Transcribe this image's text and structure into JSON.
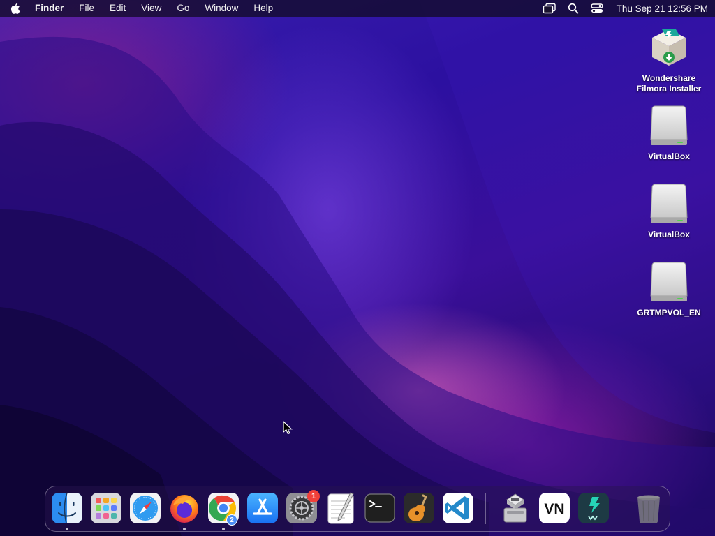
{
  "menubar": {
    "app_name": "Finder",
    "items": [
      "File",
      "Edit",
      "View",
      "Go",
      "Window",
      "Help"
    ],
    "clock": "Thu Sep 21  12:56 PM",
    "status_icons": [
      "screen-mirroring-icon",
      "spotlight-search-icon",
      "control-center-icon"
    ]
  },
  "desktop_icons": [
    {
      "label": "Wondershare Filmora Installer",
      "icon": "package-installer-icon"
    },
    {
      "label": "VirtualBox",
      "icon": "external-drive-icon"
    },
    {
      "label": "VirtualBox",
      "icon": "external-drive-icon"
    },
    {
      "label": "GRTMPVOL_EN",
      "icon": "external-drive-icon"
    }
  ],
  "dock": {
    "apps": [
      {
        "name": "Finder",
        "icon": "finder-icon",
        "running": true
      },
      {
        "name": "Launchpad",
        "icon": "launchpad-icon",
        "running": false
      },
      {
        "name": "Safari",
        "icon": "safari-icon",
        "running": false
      },
      {
        "name": "Firefox",
        "icon": "firefox-icon",
        "running": true
      },
      {
        "name": "Google Chrome",
        "icon": "chrome-icon",
        "running": true,
        "window_count": "2"
      },
      {
        "name": "App Store",
        "icon": "app-store-icon",
        "running": false
      },
      {
        "name": "System Settings",
        "icon": "system-settings-icon",
        "running": false,
        "badge": "1"
      },
      {
        "name": "TextEdit",
        "icon": "textedit-icon",
        "running": false
      },
      {
        "name": "Terminal",
        "icon": "terminal-icon",
        "running": false
      },
      {
        "name": "GarageBand",
        "icon": "garageband-icon",
        "running": false
      },
      {
        "name": "Visual Studio Code",
        "icon": "vscode-icon",
        "running": false
      },
      {
        "name": "Boot Camp Assistant",
        "icon": "disk-utility-icon",
        "running": false
      },
      {
        "name": "VN",
        "icon": "vn-icon",
        "running": false,
        "text": "VN"
      },
      {
        "name": "Wondershare Filmora",
        "icon": "filmora-icon",
        "running": false
      },
      {
        "name": "Trash",
        "icon": "trash-icon",
        "running": false
      }
    ]
  },
  "colors": {
    "badge": "#f0403a",
    "menubar_bg": "#120c28",
    "accent_chrome_badge": "#4b8ef5"
  }
}
